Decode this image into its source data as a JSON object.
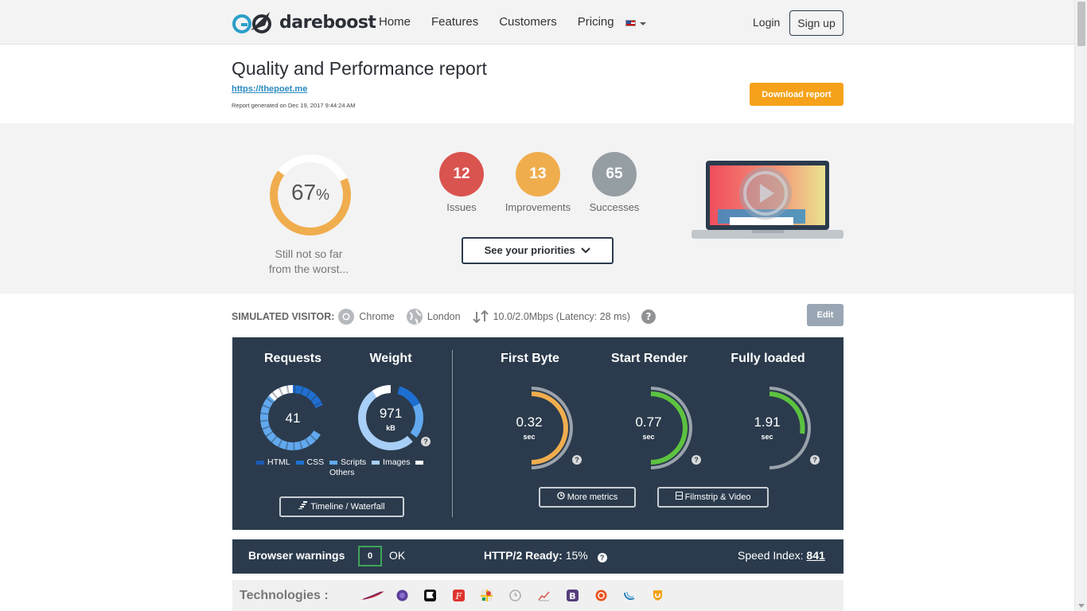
{
  "nav": {
    "brand": "dareboost",
    "items": [
      "Home",
      "Features",
      "Customers",
      "Pricing"
    ],
    "login": "Login",
    "signup": "Sign up"
  },
  "header": {
    "title": "Quality and Performance report",
    "url": "https://thepoet.me",
    "generated": "Report generated on Dec 19, 2017 9:44:24 AM",
    "download": "Download report"
  },
  "summary": {
    "score": "67",
    "score_unit": "%",
    "score_fraction": 0.67,
    "message_line1": "Still not so far",
    "message_line2": "from the worst...",
    "counts": [
      {
        "value": "12",
        "label": "Issues",
        "color": "#d9534f"
      },
      {
        "value": "13",
        "label": "Improvements",
        "color": "#f0ad4e"
      },
      {
        "value": "65",
        "label": "Successes",
        "color": "#959ea3"
      }
    ],
    "priorities": "See your priorities"
  },
  "visitor": {
    "label": "SIMULATED VISITOR:",
    "browser": "Chrome",
    "location": "London",
    "connection": "10.0/2.0Mbps (Latency: 28 ms)",
    "edit": "Edit"
  },
  "metrics": {
    "requests": {
      "title": "Requests",
      "value": "41"
    },
    "weight": {
      "title": "Weight",
      "value": "971",
      "unit": "kB"
    },
    "legend": [
      "HTML",
      "CSS",
      "Scripts",
      "Images",
      "Others"
    ],
    "timing": [
      {
        "title": "First Byte",
        "value": "0.32",
        "unit": "sec",
        "color": "#f0ad4e"
      },
      {
        "title": "Start Render",
        "value": "0.77",
        "unit": "sec",
        "color": "#5cc23f"
      },
      {
        "title": "Fully loaded",
        "value": "1.91",
        "unit": "sec",
        "color": "#5cc23f"
      }
    ],
    "timeline_btn": "Timeline / Waterfall",
    "more_metrics_btn": "More metrics",
    "filmstrip_btn": "Filmstrip & Video"
  },
  "warnings": {
    "label": "Browser warnings",
    "count": "0",
    "ok": "OK",
    "http2_label": "HTTP/2 Ready:",
    "http2_value": "15%",
    "speed_label": "Speed Index:",
    "speed_value": "841"
  },
  "technologies": {
    "label": "Technologies :"
  }
}
